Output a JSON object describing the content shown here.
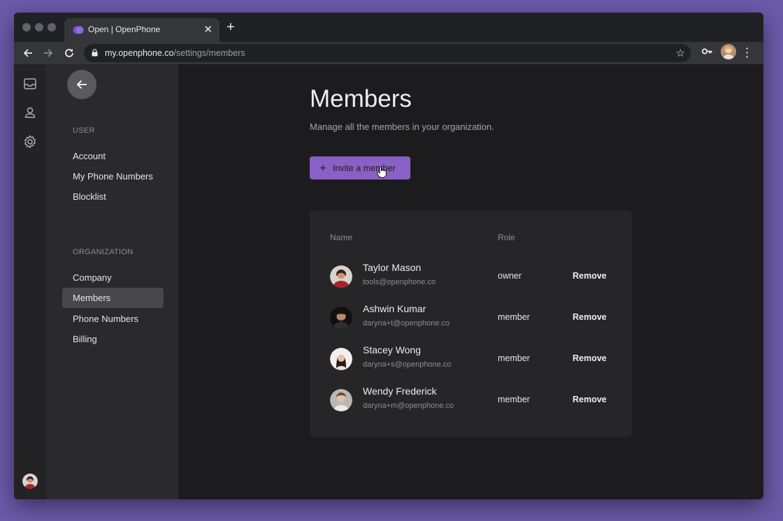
{
  "browser": {
    "tab_title": "Open | OpenPhone",
    "url_host": "my.openphone.co",
    "url_path": "/settings/members"
  },
  "rail": {
    "icons": [
      "inbox-icon",
      "contacts-icon",
      "settings-icon"
    ]
  },
  "sidebar": {
    "user_section_label": "USER",
    "user_items": [
      "Account",
      "My Phone Numbers",
      "Blocklist"
    ],
    "org_section_label": "ORGANIZATION",
    "org_items": [
      "Company",
      "Members",
      "Phone Numbers",
      "Billing"
    ],
    "active_item": "Members"
  },
  "main": {
    "title": "Members",
    "subtitle": "Manage all the members in your organization.",
    "invite_label": "Invite a member",
    "table": {
      "col_name": "Name",
      "col_role": "Role",
      "remove_label": "Remove",
      "members": [
        {
          "name": "Taylor Mason",
          "email": "tools@openphone.co",
          "role": "owner"
        },
        {
          "name": "Ashwin Kumar",
          "email": "daryna+t@openphone.co",
          "role": "member"
        },
        {
          "name": "Stacey Wong",
          "email": "daryna+s@openphone.co",
          "role": "member"
        },
        {
          "name": "Wendy Frederick",
          "email": "daryna+m@openphone.co",
          "role": "member"
        }
      ]
    }
  },
  "colors": {
    "accent": "#8a60c6",
    "background": "#1c1c1e",
    "sidebar": "#2a2a2d",
    "card": "#262628"
  }
}
